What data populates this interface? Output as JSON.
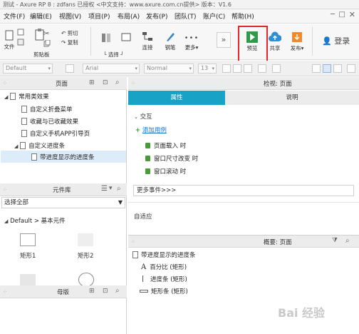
{
  "window": {
    "title": "测试 - Axure RP 8 : zdfans 已授权    <中文支持：www.axure.com.cn提供> 版本：V1.6"
  },
  "menu": {
    "items": [
      "文件(F)",
      "编辑(E)",
      "视图(V)",
      "项目(P)",
      "布局(A)",
      "发布(P)",
      "团队(T)",
      "账户(C)",
      "帮助(H)"
    ]
  },
  "toolbar": {
    "file": "文件",
    "clipboard": "剪贴板",
    "cut_label": "剪切",
    "copy_label": "复制",
    "select_label": "选择",
    "connect_label": "连接",
    "pen_label": "钢笔",
    "more_label": "更多▾",
    "preview_label": "预览",
    "share_label": "共享",
    "publish_label": "发布▾",
    "login_label": "登录"
  },
  "stylebar": {
    "style_value": "Default",
    "font_value": "Arial",
    "weight_value": "Normal",
    "size_value": "13"
  },
  "pages_panel": {
    "title": "页面",
    "items": [
      {
        "label": "常用类效果",
        "level": 0,
        "folder": true
      },
      {
        "label": "自定义折叠菜单",
        "level": 1
      },
      {
        "label": "收藏与已收藏效果",
        "level": 1
      },
      {
        "label": "自定义手机APP引导页",
        "level": 1
      },
      {
        "label": "自定义进度条",
        "level": 1,
        "folder": true
      },
      {
        "label": "带进度显示的进度条",
        "level": 2,
        "selected": true
      }
    ]
  },
  "library_panel": {
    "title": "元件库",
    "select_value": "选择全部",
    "breadcrumb": "Default > 基本元件",
    "widgets": [
      "矩形1",
      "矩形2"
    ]
  },
  "masters_panel": {
    "title": "母版"
  },
  "inspector": {
    "title": "检视: 页面",
    "tabs": [
      "属性",
      "说明"
    ],
    "section_title": "交互",
    "add_case": "添加用例",
    "events": [
      "页面载入 时",
      "窗口尺寸改变 时",
      "窗口滚动 时"
    ],
    "more_events": "更多事件>>>",
    "adaptive": "自适应"
  },
  "outline_panel": {
    "title": "概要: 页面",
    "root": "带进度显示的进度条",
    "items": [
      "百分比 (矩形)",
      "进度条 (矩形)",
      "矩形条 (矩形)"
    ]
  },
  "watermark": "Bai 经验",
  "colors": {
    "tab_active_bg": "#17a2c6",
    "preview_green": "#2e9a4a",
    "highlight_red": "#e8232a",
    "selected_row": "#dcecf9"
  }
}
